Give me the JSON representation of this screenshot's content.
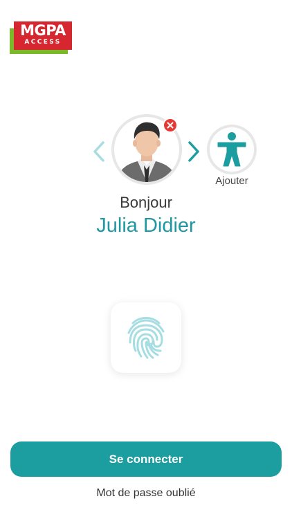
{
  "logo": {
    "brand": "MGPA",
    "sub": "ACCESS",
    "colors": {
      "red": "#d6262f",
      "green": "#7ab929"
    }
  },
  "profile": {
    "greeting": "Bonjour",
    "name": "Julia Didier",
    "avatar_icon": "user-avatar",
    "remove_icon": "close-icon"
  },
  "carousel": {
    "prev_icon": "chevron-left-icon",
    "next_icon": "chevron-right-icon"
  },
  "add_account": {
    "label": "Ajouter",
    "icon": "accessibility-person-icon"
  },
  "biometric": {
    "icon": "fingerprint-icon"
  },
  "actions": {
    "connect_label": "Se connecter",
    "forgot_label": "Mot de passe oublié"
  },
  "colors": {
    "accent": "#1c9ea0",
    "name_text": "#1f98a3",
    "badge": "#e53935"
  }
}
